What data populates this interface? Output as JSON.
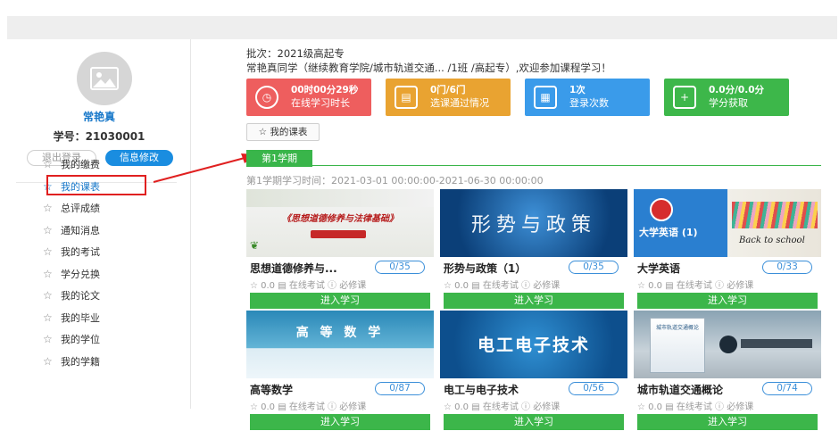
{
  "user": {
    "name": "常艳真",
    "id_line": "学号：21030001",
    "logout_label": "退出登录",
    "edit_label": "信息修改"
  },
  "menu": [
    {
      "label": "我的缴费"
    },
    {
      "label": "我的课表"
    },
    {
      "label": "总评成绩"
    },
    {
      "label": "通知消息"
    },
    {
      "label": "我的考试"
    },
    {
      "label": "学分兑换"
    },
    {
      "label": "我的论文"
    },
    {
      "label": "我的毕业"
    },
    {
      "label": "我的学位"
    },
    {
      "label": "我的学籍"
    }
  ],
  "header": {
    "batch": "批次：2021级高起专",
    "welcome": "常艳真同学（继续教育学院/城市轨道交通...  /1班 /高起专）,欢迎参加课程学习！"
  },
  "stats": [
    {
      "value": "00时00分29秒",
      "label": "在线学习时长",
      "color": "#ee5e5e",
      "icon": "clock-icon"
    },
    {
      "value": "0门/6门",
      "label": "选课通过情况",
      "color": "#e9a331",
      "icon": "document-icon"
    },
    {
      "value": "1次",
      "label": "登录次数",
      "color": "#3a9bea",
      "icon": "calendar-icon"
    },
    {
      "value": "0.0分/0.0分",
      "label": "学分获取",
      "color": "#3db74a",
      "icon": "credit-icon"
    }
  ],
  "my_course_btn": "☆ 我的课表",
  "tab_label": "第1学期",
  "term_info": "第1学期学习时间：2021-03-01 00:00:00-2021-06-30 00:00:00",
  "courses": [
    {
      "name": "思想道德修养与...",
      "progress": "0/35",
      "thumb_text": "《思想道德修养与法律基础》",
      "meta": "☆ 0.0  ▤ 在线考试  ⓘ 必修课",
      "enter": "进入学习"
    },
    {
      "name": "形势与政策（1）",
      "progress": "0/35",
      "thumb_text": "形势与政策",
      "meta": "☆ 0.0  ▤ 在线考试  ⓘ 必修课",
      "enter": "进入学习"
    },
    {
      "name": "大学英语",
      "progress": "0/33",
      "thumb_text": "大学英语 (1)",
      "thumb_text2": "Back to school",
      "meta": "☆ 0.0  ▤ 在线考试  ⓘ 必修课",
      "enter": "进入学习"
    },
    {
      "name": "高等数学",
      "progress": "0/87",
      "thumb_text": "高 等 数 学",
      "meta": "☆ 0.0  ▤ 在线考试  ⓘ 必修课",
      "enter": "进入学习"
    },
    {
      "name": "电工与电子技术",
      "progress": "0/56",
      "thumb_text": "电工电子技术",
      "meta": "☆ 0.0  ▤ 在线考试  ⓘ 必修课",
      "enter": "进入学习"
    },
    {
      "name": "城市轨道交通概论",
      "progress": "0/74",
      "thumb_text": "城市轨道交通概论",
      "meta": "☆ 0.0  ▤ 在线考试  ⓘ 必修课",
      "enter": "进入学习"
    }
  ]
}
